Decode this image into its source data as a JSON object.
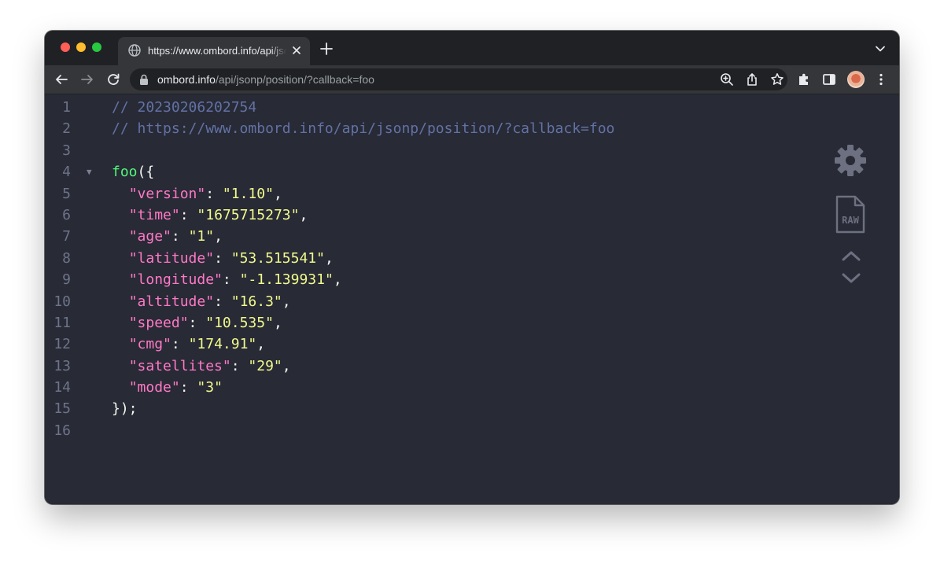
{
  "browser": {
    "tab": {
      "title": "https://www.ombord.info/api/jsonp/position/?callback=foo",
      "icon": "globe-icon"
    },
    "omnibox": {
      "host": "ombord.info",
      "path": "/api/jsonp/position/?callback=foo"
    }
  },
  "viewer": {
    "raw_label": "RAW",
    "lines": [
      {
        "num": "1",
        "parts": [
          {
            "cls": "comment",
            "text": "// 20230206202754"
          }
        ]
      },
      {
        "num": "2",
        "parts": [
          {
            "cls": "comment",
            "text": "// https://www.ombord.info/api/jsonp/position/?callback=foo"
          }
        ]
      },
      {
        "num": "3",
        "parts": []
      },
      {
        "num": "4",
        "fold": "▼",
        "parts": [
          {
            "cls": "fn",
            "text": "foo"
          },
          {
            "cls": "punc",
            "text": "({"
          }
        ]
      },
      {
        "num": "5",
        "parts": [
          {
            "cls": "punc",
            "text": "  "
          },
          {
            "cls": "key",
            "text": "\"version\""
          },
          {
            "cls": "punc",
            "text": ": "
          },
          {
            "cls": "str",
            "text": "\"1.10\""
          },
          {
            "cls": "punc",
            "text": ","
          }
        ]
      },
      {
        "num": "6",
        "parts": [
          {
            "cls": "punc",
            "text": "  "
          },
          {
            "cls": "key",
            "text": "\"time\""
          },
          {
            "cls": "punc",
            "text": ": "
          },
          {
            "cls": "str",
            "text": "\"1675715273\""
          },
          {
            "cls": "punc",
            "text": ","
          }
        ]
      },
      {
        "num": "7",
        "parts": [
          {
            "cls": "punc",
            "text": "  "
          },
          {
            "cls": "key",
            "text": "\"age\""
          },
          {
            "cls": "punc",
            "text": ": "
          },
          {
            "cls": "str",
            "text": "\"1\""
          },
          {
            "cls": "punc",
            "text": ","
          }
        ]
      },
      {
        "num": "8",
        "parts": [
          {
            "cls": "punc",
            "text": "  "
          },
          {
            "cls": "key",
            "text": "\"latitude\""
          },
          {
            "cls": "punc",
            "text": ": "
          },
          {
            "cls": "str",
            "text": "\"53.515541\""
          },
          {
            "cls": "punc",
            "text": ","
          }
        ]
      },
      {
        "num": "9",
        "parts": [
          {
            "cls": "punc",
            "text": "  "
          },
          {
            "cls": "key",
            "text": "\"longitude\""
          },
          {
            "cls": "punc",
            "text": ": "
          },
          {
            "cls": "str",
            "text": "\"-1.139931\""
          },
          {
            "cls": "punc",
            "text": ","
          }
        ]
      },
      {
        "num": "10",
        "parts": [
          {
            "cls": "punc",
            "text": "  "
          },
          {
            "cls": "key",
            "text": "\"altitude\""
          },
          {
            "cls": "punc",
            "text": ": "
          },
          {
            "cls": "str",
            "text": "\"16.3\""
          },
          {
            "cls": "punc",
            "text": ","
          }
        ]
      },
      {
        "num": "11",
        "parts": [
          {
            "cls": "punc",
            "text": "  "
          },
          {
            "cls": "key",
            "text": "\"speed\""
          },
          {
            "cls": "punc",
            "text": ": "
          },
          {
            "cls": "str",
            "text": "\"10.535\""
          },
          {
            "cls": "punc",
            "text": ","
          }
        ]
      },
      {
        "num": "12",
        "parts": [
          {
            "cls": "punc",
            "text": "  "
          },
          {
            "cls": "key",
            "text": "\"cmg\""
          },
          {
            "cls": "punc",
            "text": ": "
          },
          {
            "cls": "str",
            "text": "\"174.91\""
          },
          {
            "cls": "punc",
            "text": ","
          }
        ]
      },
      {
        "num": "13",
        "parts": [
          {
            "cls": "punc",
            "text": "  "
          },
          {
            "cls": "key",
            "text": "\"satellites\""
          },
          {
            "cls": "punc",
            "text": ": "
          },
          {
            "cls": "str",
            "text": "\"29\""
          },
          {
            "cls": "punc",
            "text": ","
          }
        ]
      },
      {
        "num": "14",
        "parts": [
          {
            "cls": "punc",
            "text": "  "
          },
          {
            "cls": "key",
            "text": "\"mode\""
          },
          {
            "cls": "punc",
            "text": ": "
          },
          {
            "cls": "str",
            "text": "\"3\""
          }
        ]
      },
      {
        "num": "15",
        "parts": [
          {
            "cls": "punc",
            "text": "});"
          }
        ]
      },
      {
        "num": "16",
        "parts": []
      }
    ]
  }
}
